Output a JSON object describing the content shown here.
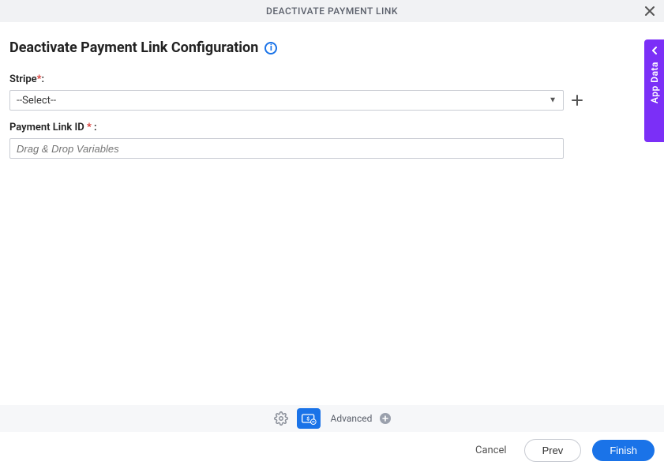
{
  "header": {
    "title": "DEACTIVATE PAYMENT LINK"
  },
  "page": {
    "title": "Deactivate Payment Link Configuration"
  },
  "fields": {
    "stripe": {
      "label": "Stripe",
      "value": "--Select--"
    },
    "payment_link_id": {
      "label": "Payment Link ID ",
      "placeholder": "Drag & Drop Variables",
      "value": ""
    }
  },
  "side_panel": {
    "label": "App Data"
  },
  "toolbar": {
    "advanced_label": "Advanced"
  },
  "footer": {
    "cancel": "Cancel",
    "prev": "Prev",
    "finish": "Finish"
  }
}
